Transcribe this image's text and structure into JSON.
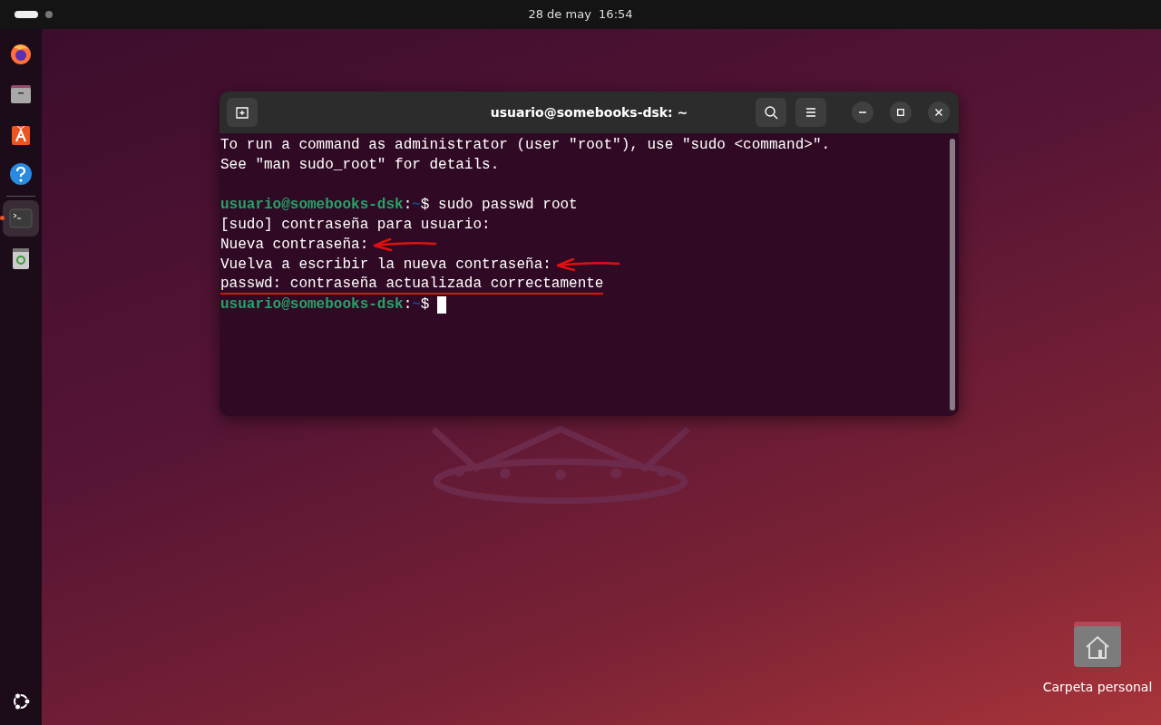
{
  "top_bar": {
    "workspaces": [
      {
        "selected": true
      },
      {
        "selected": false
      }
    ],
    "clock": "28 de may  16:54"
  },
  "dock": {
    "items": [
      {
        "running": false
      },
      {
        "running": false
      },
      {
        "running": false
      },
      {
        "running": false
      },
      {
        "running": true
      },
      {
        "running": false
      }
    ]
  },
  "terminal": {
    "title": "usuario@somebooks-dsk: ~",
    "lines": [
      {
        "kind": "output",
        "text": "To run a command as administrator (user \"root\"), use \"sudo <command>\"."
      },
      {
        "kind": "output",
        "text": "See \"man sudo_root\" for details."
      },
      {
        "kind": "blank"
      },
      {
        "kind": "prompt",
        "user_host": "usuario@somebooks-dsk",
        "separator": ":",
        "path": "~",
        "symbol": "$",
        "command": "sudo passwd root"
      },
      {
        "kind": "output",
        "text": "[sudo] contraseña para usuario:"
      },
      {
        "kind": "output",
        "text": "Nueva contraseña:",
        "arrow": true
      },
      {
        "kind": "output",
        "text": "Vuelva a escribir la nueva contraseña:",
        "arrow": true
      },
      {
        "kind": "output",
        "text": "passwd: contraseña actualizada correctamente",
        "underlined": true
      },
      {
        "kind": "prompt",
        "user_host": "usuario@somebooks-dsk",
        "separator": ":",
        "path": "~",
        "symbol": "$",
        "cursor": true
      }
    ]
  },
  "desktop_icons": [
    {
      "label": "Carpeta personal"
    }
  ]
}
